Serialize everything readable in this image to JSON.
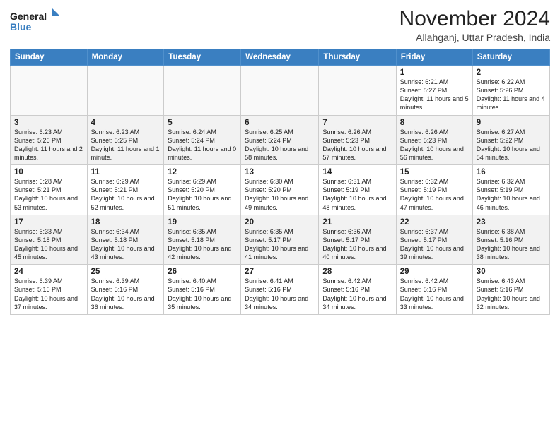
{
  "header": {
    "logo_line1": "General",
    "logo_line2": "Blue",
    "month_title": "November 2024",
    "location": "Allahganj, Uttar Pradesh, India"
  },
  "weekdays": [
    "Sunday",
    "Monday",
    "Tuesday",
    "Wednesday",
    "Thursday",
    "Friday",
    "Saturday"
  ],
  "weeks": [
    [
      {
        "day": "",
        "info": ""
      },
      {
        "day": "",
        "info": ""
      },
      {
        "day": "",
        "info": ""
      },
      {
        "day": "",
        "info": ""
      },
      {
        "day": "",
        "info": ""
      },
      {
        "day": "1",
        "info": "Sunrise: 6:21 AM\nSunset: 5:27 PM\nDaylight: 11 hours\nand 5 minutes."
      },
      {
        "day": "2",
        "info": "Sunrise: 6:22 AM\nSunset: 5:26 PM\nDaylight: 11 hours\nand 4 minutes."
      }
    ],
    [
      {
        "day": "3",
        "info": "Sunrise: 6:23 AM\nSunset: 5:26 PM\nDaylight: 11 hours\nand 2 minutes."
      },
      {
        "day": "4",
        "info": "Sunrise: 6:23 AM\nSunset: 5:25 PM\nDaylight: 11 hours\nand 1 minute."
      },
      {
        "day": "5",
        "info": "Sunrise: 6:24 AM\nSunset: 5:24 PM\nDaylight: 11 hours\nand 0 minutes."
      },
      {
        "day": "6",
        "info": "Sunrise: 6:25 AM\nSunset: 5:24 PM\nDaylight: 10 hours\nand 58 minutes."
      },
      {
        "day": "7",
        "info": "Sunrise: 6:26 AM\nSunset: 5:23 PM\nDaylight: 10 hours\nand 57 minutes."
      },
      {
        "day": "8",
        "info": "Sunrise: 6:26 AM\nSunset: 5:23 PM\nDaylight: 10 hours\nand 56 minutes."
      },
      {
        "day": "9",
        "info": "Sunrise: 6:27 AM\nSunset: 5:22 PM\nDaylight: 10 hours\nand 54 minutes."
      }
    ],
    [
      {
        "day": "10",
        "info": "Sunrise: 6:28 AM\nSunset: 5:21 PM\nDaylight: 10 hours\nand 53 minutes."
      },
      {
        "day": "11",
        "info": "Sunrise: 6:29 AM\nSunset: 5:21 PM\nDaylight: 10 hours\nand 52 minutes."
      },
      {
        "day": "12",
        "info": "Sunrise: 6:29 AM\nSunset: 5:20 PM\nDaylight: 10 hours\nand 51 minutes."
      },
      {
        "day": "13",
        "info": "Sunrise: 6:30 AM\nSunset: 5:20 PM\nDaylight: 10 hours\nand 49 minutes."
      },
      {
        "day": "14",
        "info": "Sunrise: 6:31 AM\nSunset: 5:19 PM\nDaylight: 10 hours\nand 48 minutes."
      },
      {
        "day": "15",
        "info": "Sunrise: 6:32 AM\nSunset: 5:19 PM\nDaylight: 10 hours\nand 47 minutes."
      },
      {
        "day": "16",
        "info": "Sunrise: 6:32 AM\nSunset: 5:19 PM\nDaylight: 10 hours\nand 46 minutes."
      }
    ],
    [
      {
        "day": "17",
        "info": "Sunrise: 6:33 AM\nSunset: 5:18 PM\nDaylight: 10 hours\nand 45 minutes."
      },
      {
        "day": "18",
        "info": "Sunrise: 6:34 AM\nSunset: 5:18 PM\nDaylight: 10 hours\nand 43 minutes."
      },
      {
        "day": "19",
        "info": "Sunrise: 6:35 AM\nSunset: 5:18 PM\nDaylight: 10 hours\nand 42 minutes."
      },
      {
        "day": "20",
        "info": "Sunrise: 6:35 AM\nSunset: 5:17 PM\nDaylight: 10 hours\nand 41 minutes."
      },
      {
        "day": "21",
        "info": "Sunrise: 6:36 AM\nSunset: 5:17 PM\nDaylight: 10 hours\nand 40 minutes."
      },
      {
        "day": "22",
        "info": "Sunrise: 6:37 AM\nSunset: 5:17 PM\nDaylight: 10 hours\nand 39 minutes."
      },
      {
        "day": "23",
        "info": "Sunrise: 6:38 AM\nSunset: 5:16 PM\nDaylight: 10 hours\nand 38 minutes."
      }
    ],
    [
      {
        "day": "24",
        "info": "Sunrise: 6:39 AM\nSunset: 5:16 PM\nDaylight: 10 hours\nand 37 minutes."
      },
      {
        "day": "25",
        "info": "Sunrise: 6:39 AM\nSunset: 5:16 PM\nDaylight: 10 hours\nand 36 minutes."
      },
      {
        "day": "26",
        "info": "Sunrise: 6:40 AM\nSunset: 5:16 PM\nDaylight: 10 hours\nand 35 minutes."
      },
      {
        "day": "27",
        "info": "Sunrise: 6:41 AM\nSunset: 5:16 PM\nDaylight: 10 hours\nand 34 minutes."
      },
      {
        "day": "28",
        "info": "Sunrise: 6:42 AM\nSunset: 5:16 PM\nDaylight: 10 hours\nand 34 minutes."
      },
      {
        "day": "29",
        "info": "Sunrise: 6:42 AM\nSunset: 5:16 PM\nDaylight: 10 hours\nand 33 minutes."
      },
      {
        "day": "30",
        "info": "Sunrise: 6:43 AM\nSunset: 5:16 PM\nDaylight: 10 hours\nand 32 minutes."
      }
    ]
  ]
}
